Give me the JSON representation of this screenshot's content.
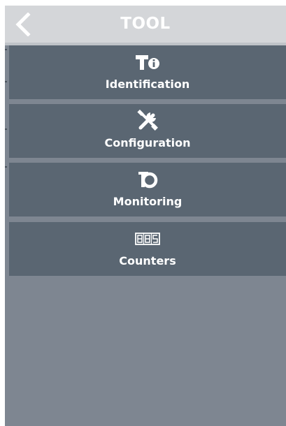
{
  "header": {
    "title": "TOOL",
    "back_icon": "chevron-left-icon"
  },
  "menu": {
    "items": [
      {
        "label": "Identification",
        "icon": "tool-info-icon"
      },
      {
        "label": "Configuration",
        "icon": "wrench-screwdriver-icon"
      },
      {
        "label": "Monitoring",
        "icon": "monitoring-icon"
      },
      {
        "label": "Counters",
        "icon": "counter-digits-icon"
      }
    ]
  },
  "colors": {
    "header_bg": "#d4d6d9",
    "menu_item_bg": "#5a6672",
    "panel_bg": "#7e8691",
    "text": "#ffffff"
  }
}
